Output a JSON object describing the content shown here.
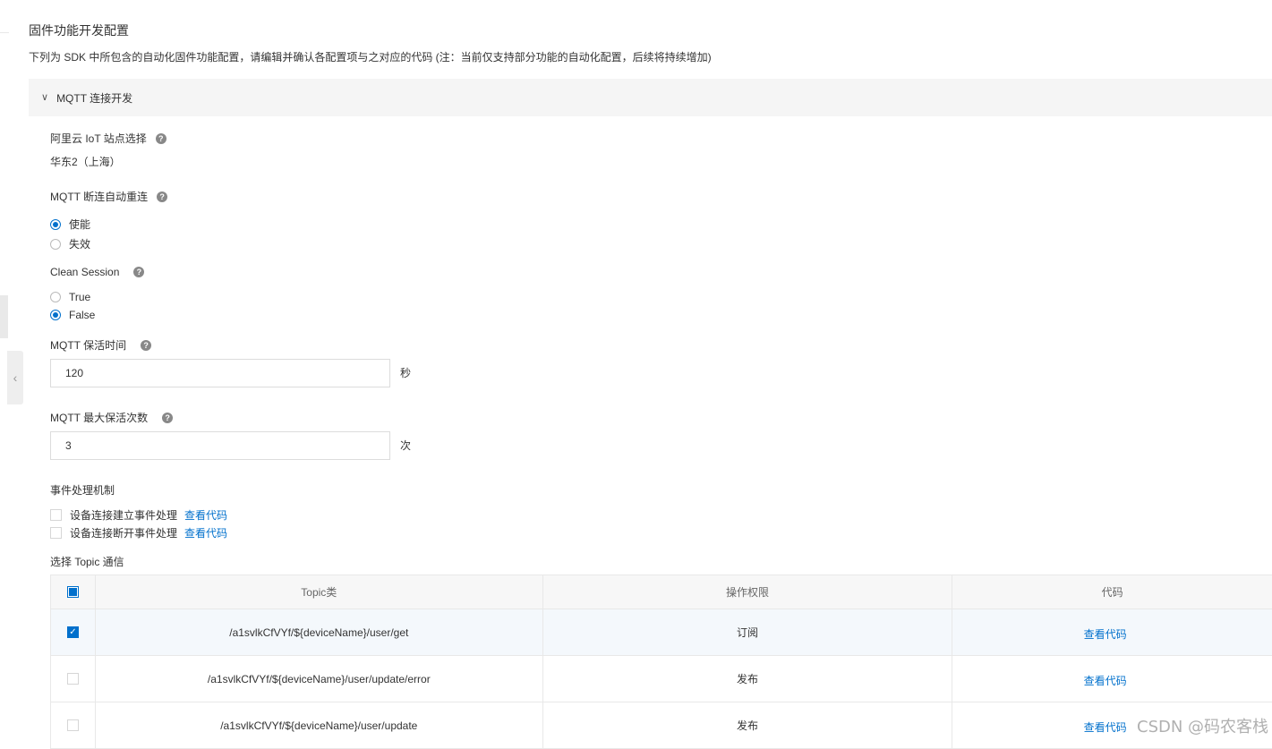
{
  "page": {
    "title": "固件功能开发配置",
    "description": "下列为 SDK 中所包含的自动化固件功能配置，请编辑并确认各配置项与之对应的代码 (注：当前仅支持部分功能的自动化配置，后续将持续增加)"
  },
  "panel": {
    "title": "MQTT 连接开发",
    "expanded": true
  },
  "site": {
    "label": "阿里云 IoT 站点选择",
    "value": "华东2（上海）"
  },
  "reconnect": {
    "label": "MQTT 断连自动重连",
    "options": [
      {
        "label": "使能",
        "checked": true
      },
      {
        "label": "失效",
        "checked": false
      }
    ]
  },
  "clean_session": {
    "label": "Clean Session",
    "options": [
      {
        "label": "True",
        "checked": false
      },
      {
        "label": "False",
        "checked": true
      }
    ]
  },
  "keepalive": {
    "label": "MQTT 保活时间",
    "value": "120",
    "unit": "秒"
  },
  "max_keepalive": {
    "label": "MQTT 最大保活次数",
    "value": "3",
    "unit": "次"
  },
  "events": {
    "label": "事件处理机制",
    "items": [
      {
        "label": "设备连接建立事件处理",
        "link": "查看代码",
        "checked": false
      },
      {
        "label": "设备连接断开事件处理",
        "link": "查看代码",
        "checked": false
      }
    ]
  },
  "topics": {
    "label": "选择 Topic 通信",
    "columns": [
      "Topic类",
      "操作权限",
      "代码"
    ],
    "rows": [
      {
        "topic": "/a1svlkCfVYf/${deviceName}/user/get",
        "permission": "订阅",
        "code": "查看代码",
        "checked": true
      },
      {
        "topic": "/a1svlkCfVYf/${deviceName}/user/update/error",
        "permission": "发布",
        "code": "查看代码",
        "checked": false
      },
      {
        "topic": "/a1svlkCfVYf/${deviceName}/user/update",
        "permission": "发布",
        "code": "查看代码",
        "checked": false
      }
    ]
  },
  "watermark": "CSDN @码农客栈",
  "colors": {
    "accent": "#0070cc",
    "panel_bg": "#f5f5f5",
    "border": "#e8e8e8"
  }
}
